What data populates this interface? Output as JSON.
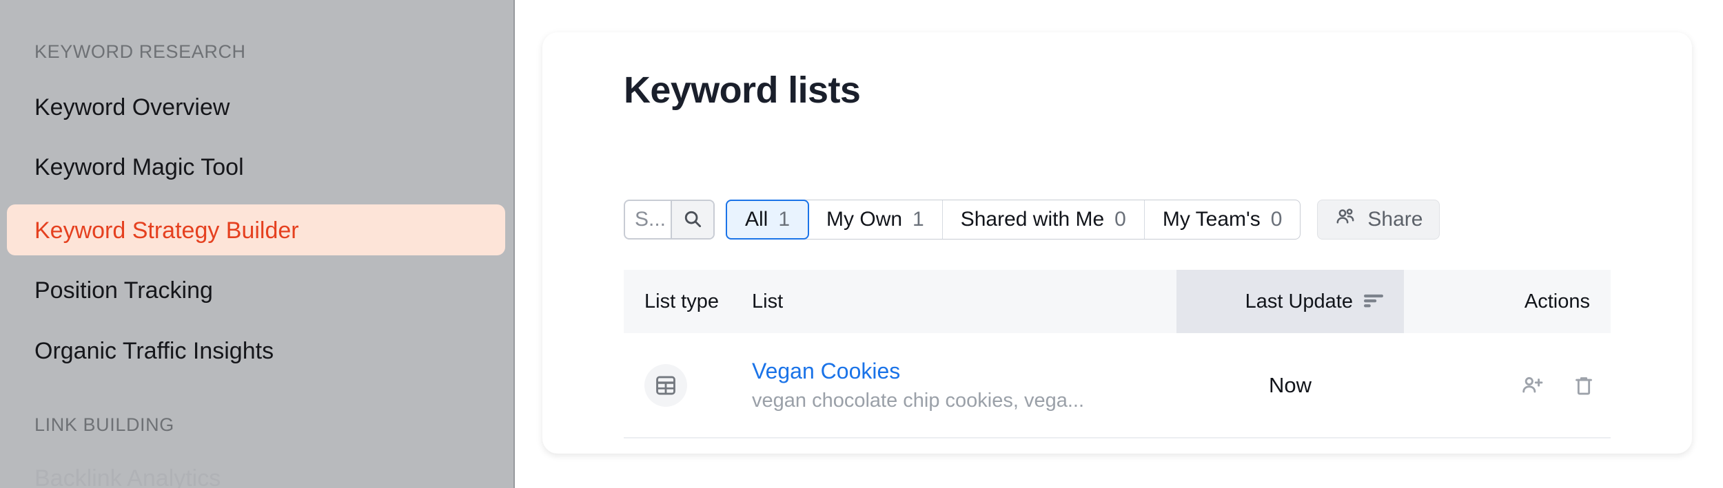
{
  "sidebar": {
    "sections": [
      {
        "label": "KEYWORD RESEARCH",
        "items": [
          {
            "label": "Keyword Overview",
            "active": false
          },
          {
            "label": "Keyword Magic Tool",
            "active": false
          },
          {
            "label": "Keyword Strategy Builder",
            "active": true
          },
          {
            "label": "Position Tracking",
            "active": false
          },
          {
            "label": "Organic Traffic Insights",
            "active": false
          }
        ]
      },
      {
        "label": "LINK BUILDING",
        "items": [
          {
            "label": "Backlink Analytics",
            "active": false
          }
        ]
      }
    ],
    "active_color": "#e5401f",
    "active_bg": "#fde4d8",
    "bg": "#b8babd"
  },
  "card": {
    "title": "Keyword lists",
    "search": {
      "value": "",
      "placeholder": "S...",
      "icon": "search-icon"
    },
    "tabs": [
      {
        "label": "All",
        "count": "1",
        "active": true
      },
      {
        "label": "My Own",
        "count": "1",
        "active": false
      },
      {
        "label": "Shared with Me",
        "count": "0",
        "active": false
      },
      {
        "label": "My Team's",
        "count": "0",
        "active": false
      }
    ],
    "share_button": {
      "label": "Share",
      "icon": "people-icon"
    },
    "table": {
      "columns": [
        {
          "key": "list_type",
          "label": "List type",
          "align": "left"
        },
        {
          "key": "list",
          "label": "List",
          "align": "left"
        },
        {
          "key": "last_update",
          "label": "Last Update",
          "align": "right",
          "sorted": true,
          "sort_icon": "sort-descending-icon"
        },
        {
          "key": "actions",
          "label": "Actions",
          "align": "right"
        }
      ],
      "rows": [
        {
          "list_type_icon": "table-list-icon",
          "name": "Vegan Cookies",
          "keywords": "vegan chocolate chip cookies, vega...",
          "last_update": "Now",
          "actions": [
            {
              "name": "share-list-icon",
              "label": "add-person"
            },
            {
              "name": "delete-list-icon",
              "label": "trash"
            }
          ]
        }
      ]
    },
    "accent_blue": "#1a73e8",
    "header_bg": "#f6f7f9",
    "sorted_col_bg": "#e4e6ec"
  }
}
